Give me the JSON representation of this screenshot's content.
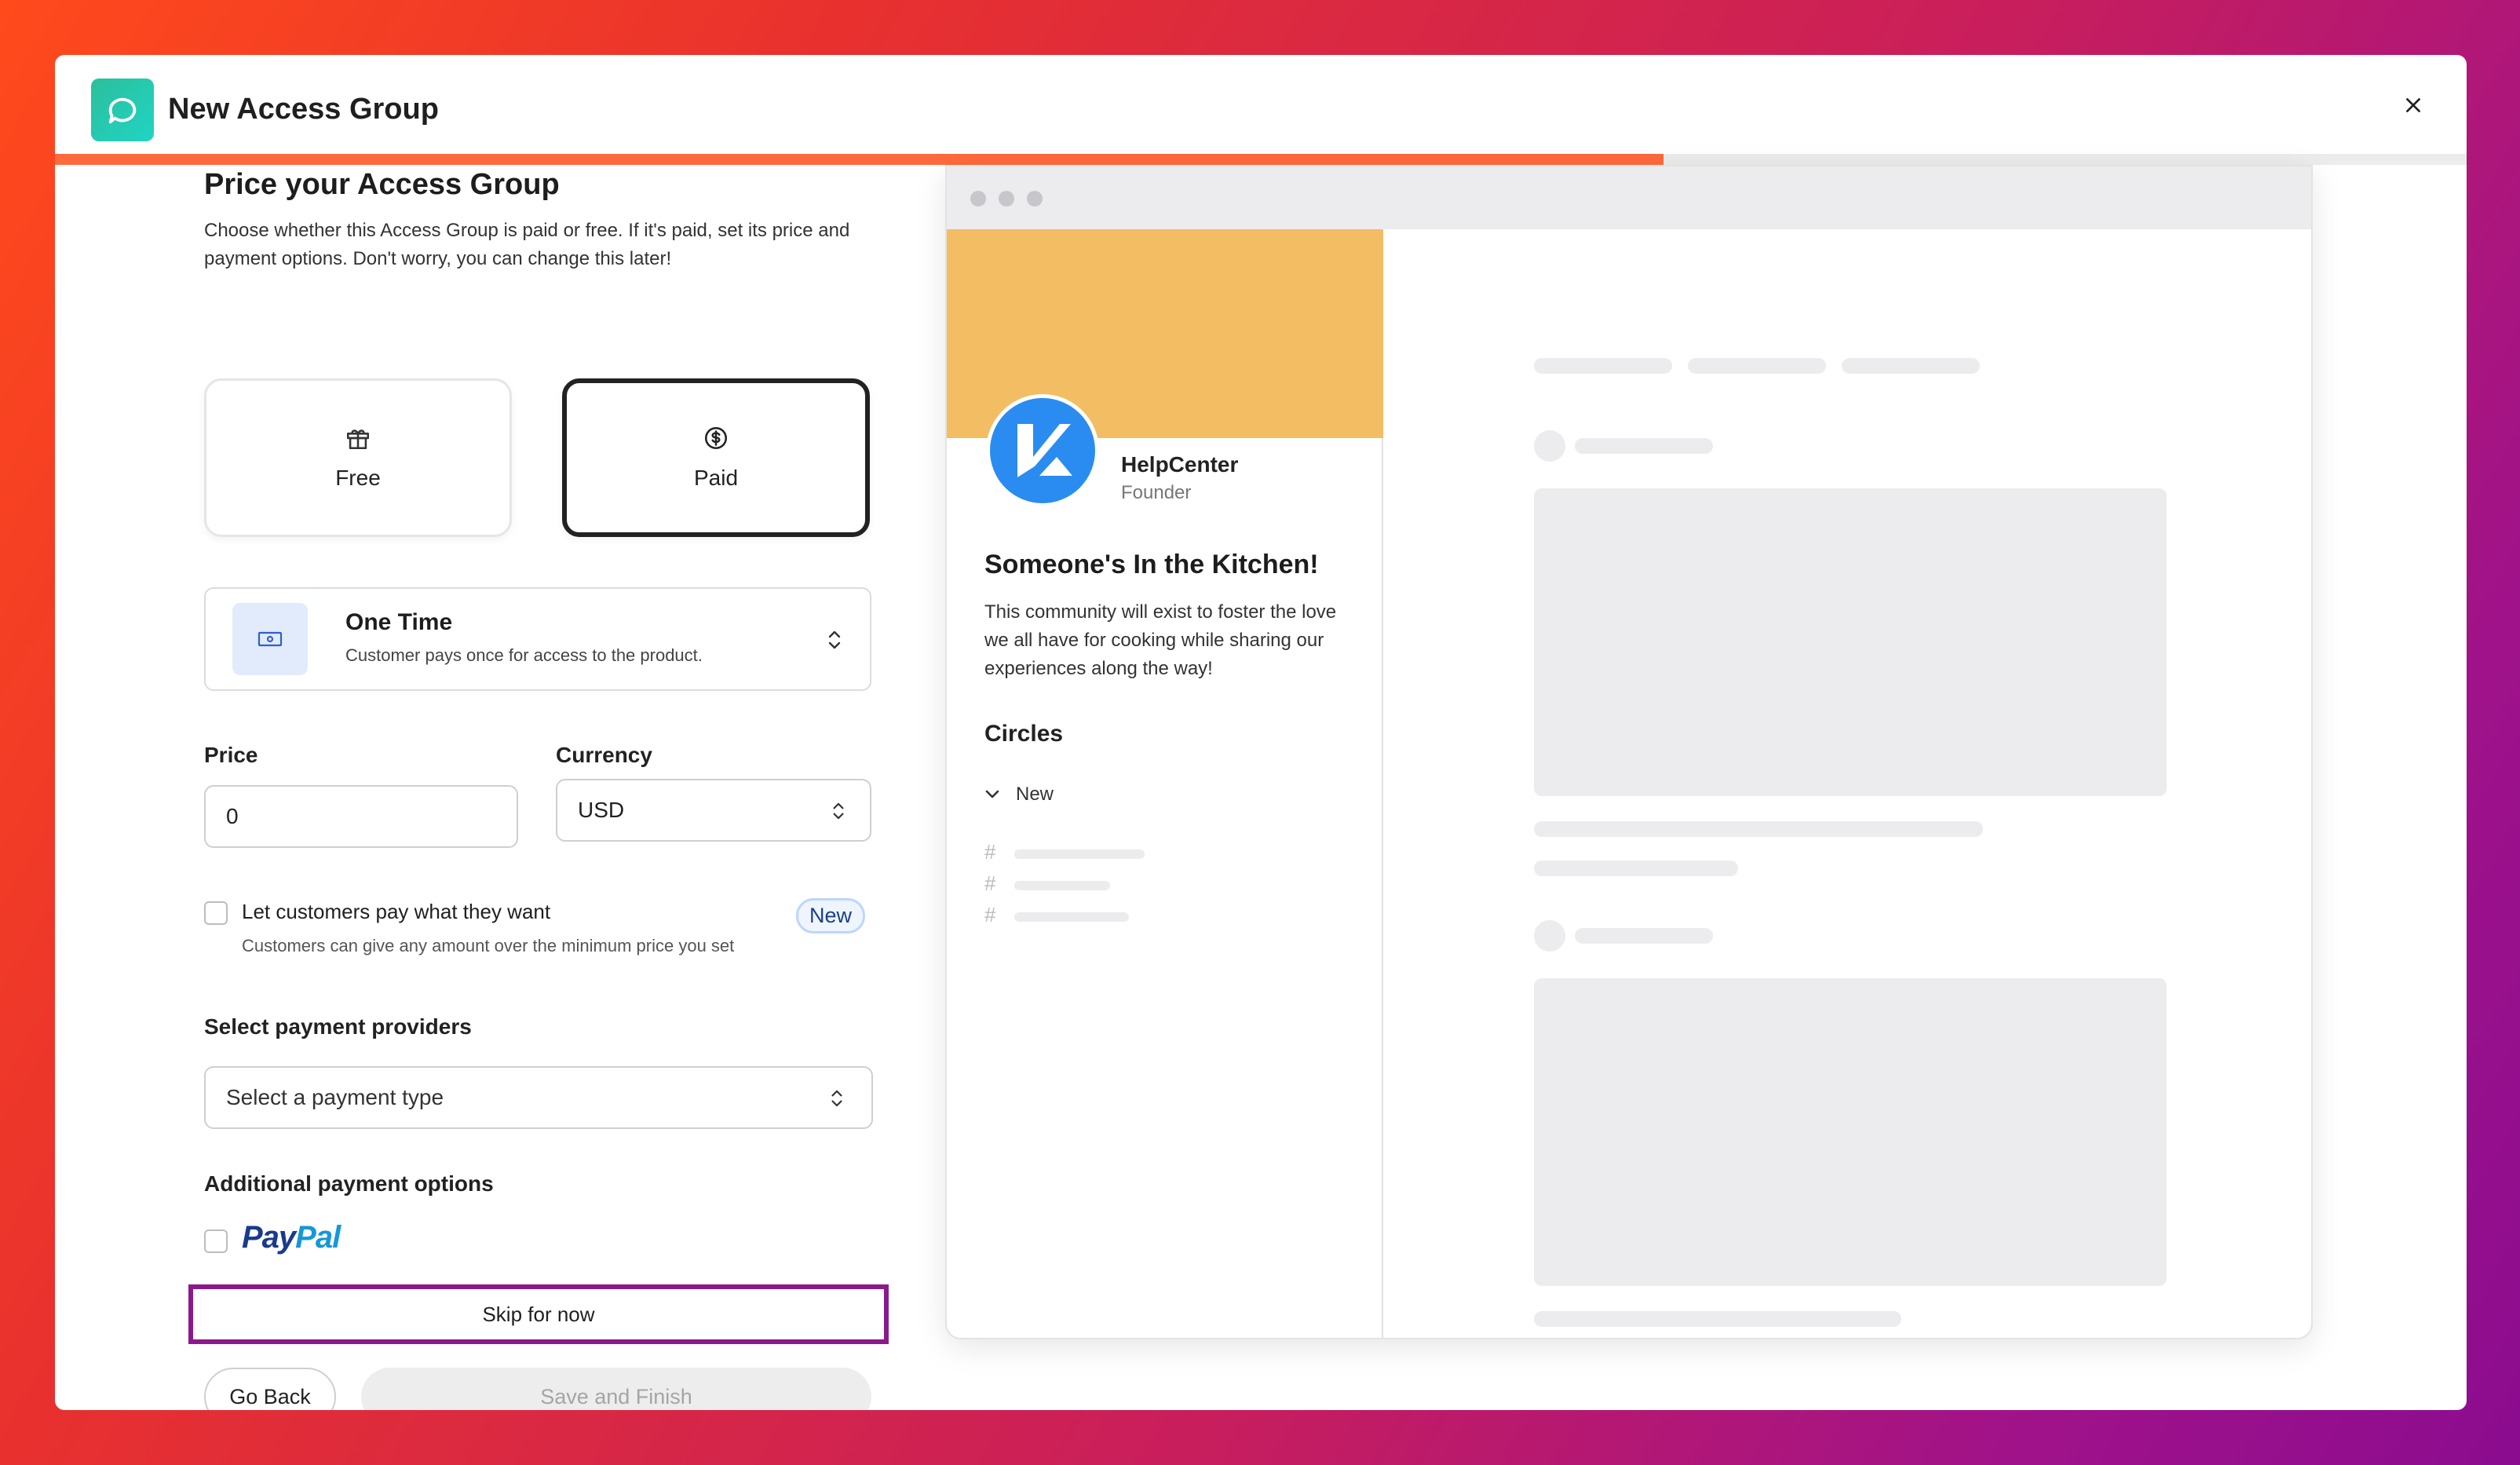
{
  "header": {
    "title": "New Access Group",
    "progress_percent": 66.7
  },
  "form": {
    "heading": "Price your Access Group",
    "description": "Choose whether this Access Group is paid or free. If it's paid, set its price and payment options. Don't worry, you can change this later!",
    "pricing_options": [
      {
        "label": "Free",
        "icon": "gift-icon",
        "selected": false
      },
      {
        "label": "Paid",
        "icon": "dollar-circle-icon",
        "selected": true
      }
    ],
    "billing": {
      "title": "One Time",
      "subtitle": "Customer pays once for access to the product."
    },
    "price": {
      "label": "Price",
      "value": "0"
    },
    "currency": {
      "label": "Currency",
      "value": "USD"
    },
    "pay_what_you_want": {
      "label": "Let customers pay what they want",
      "sub": "Customers can give any amount over the minimum price you set",
      "badge": "New",
      "checked": false
    },
    "providers": {
      "label": "Select payment providers",
      "placeholder": "Select a payment type"
    },
    "additional": {
      "label": "Additional payment options",
      "paypal_part1": "Pay",
      "paypal_part2": "Pal",
      "checked": false
    },
    "skip_label": "Skip for now",
    "back_label": "Go Back",
    "save_label": "Save and Finish"
  },
  "preview": {
    "profile_name": "HelpCenter",
    "profile_role": "Founder",
    "community_title": "Someone's In the Kitchen!",
    "community_desc": "This community will exist to foster the love we all have for cooking while sharing our experiences along the way!",
    "circles_label": "Circles",
    "new_label": "New",
    "hash_symbol": "#",
    "banner_color": "#f3bd63",
    "avatar_color": "#2a8cf0"
  },
  "colors": {
    "progress": "#ff6a3d",
    "highlight_border": "#8a1a8c",
    "brand": "#2bbf9b"
  }
}
